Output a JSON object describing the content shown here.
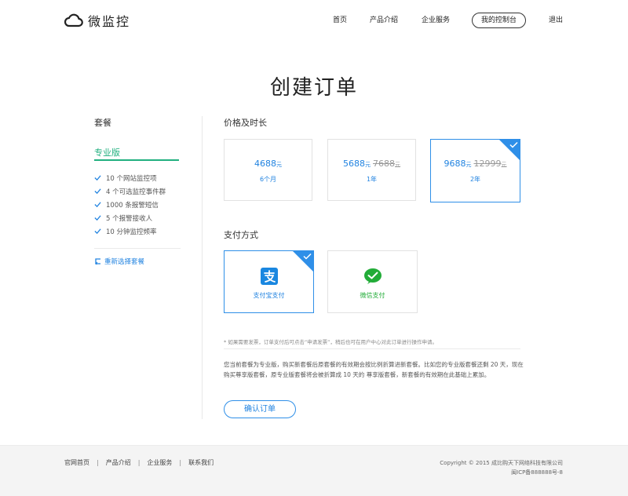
{
  "header": {
    "brand": "微监控",
    "nav": {
      "home": "首页",
      "products": "产品介绍",
      "enterprise": "企业服务",
      "console": "我的控制台",
      "logout": "退出"
    }
  },
  "page_title": "创建订单",
  "plan": {
    "heading": "套餐",
    "name": "专业版",
    "features": [
      "10 个网站监控项",
      "4 个可选监控事件群",
      "1000 条报警短信",
      "5 个报警接收人",
      "10 分钟监控频率"
    ],
    "reselect": "重新选择套餐"
  },
  "pricing": {
    "title": "价格及时长",
    "unit": "元",
    "options": [
      {
        "price": "4688",
        "old_price": "",
        "duration": "6个月",
        "selected": false
      },
      {
        "price": "5688",
        "old_price": "7688",
        "duration": "1年",
        "selected": false
      },
      {
        "price": "9688",
        "old_price": "12999",
        "duration": "2年",
        "selected": true
      }
    ]
  },
  "payment": {
    "title": "支付方式",
    "methods": [
      {
        "label": "支付宝支付",
        "icon": "alipay-icon",
        "color": "#2183e0",
        "selected": true
      },
      {
        "label": "微信支付",
        "icon": "wechat-pay-icon",
        "color": "#22ac38",
        "selected": false
      }
    ]
  },
  "note": "* 如果需要发票，订单支付后可点击“申请发票”，稍后也可在用户中心对此订单进行操作申请。",
  "info": "您当前套餐为专业版，购买新套餐后原套餐的有效期会按比例折算进新套餐。比如您的专业版套餐还剩 20 天，现在购买尊享版套餐，原专业版套餐将会被折算成 10 天的 尊享版套餐，新套餐的有效期在此基础上累加。",
  "confirm_label": "确认订单",
  "footer": {
    "links": [
      "官网首页",
      "产品介绍",
      "企业服务",
      "联系我们"
    ],
    "copyright": "Copyright © 2015 成比购天下网络科技有限公司",
    "icp": "闽ICP备888888号-8"
  },
  "colors": {
    "accent": "#2f8fe8",
    "plan_green": "#21b07f",
    "wechat_green": "#22ac38"
  }
}
